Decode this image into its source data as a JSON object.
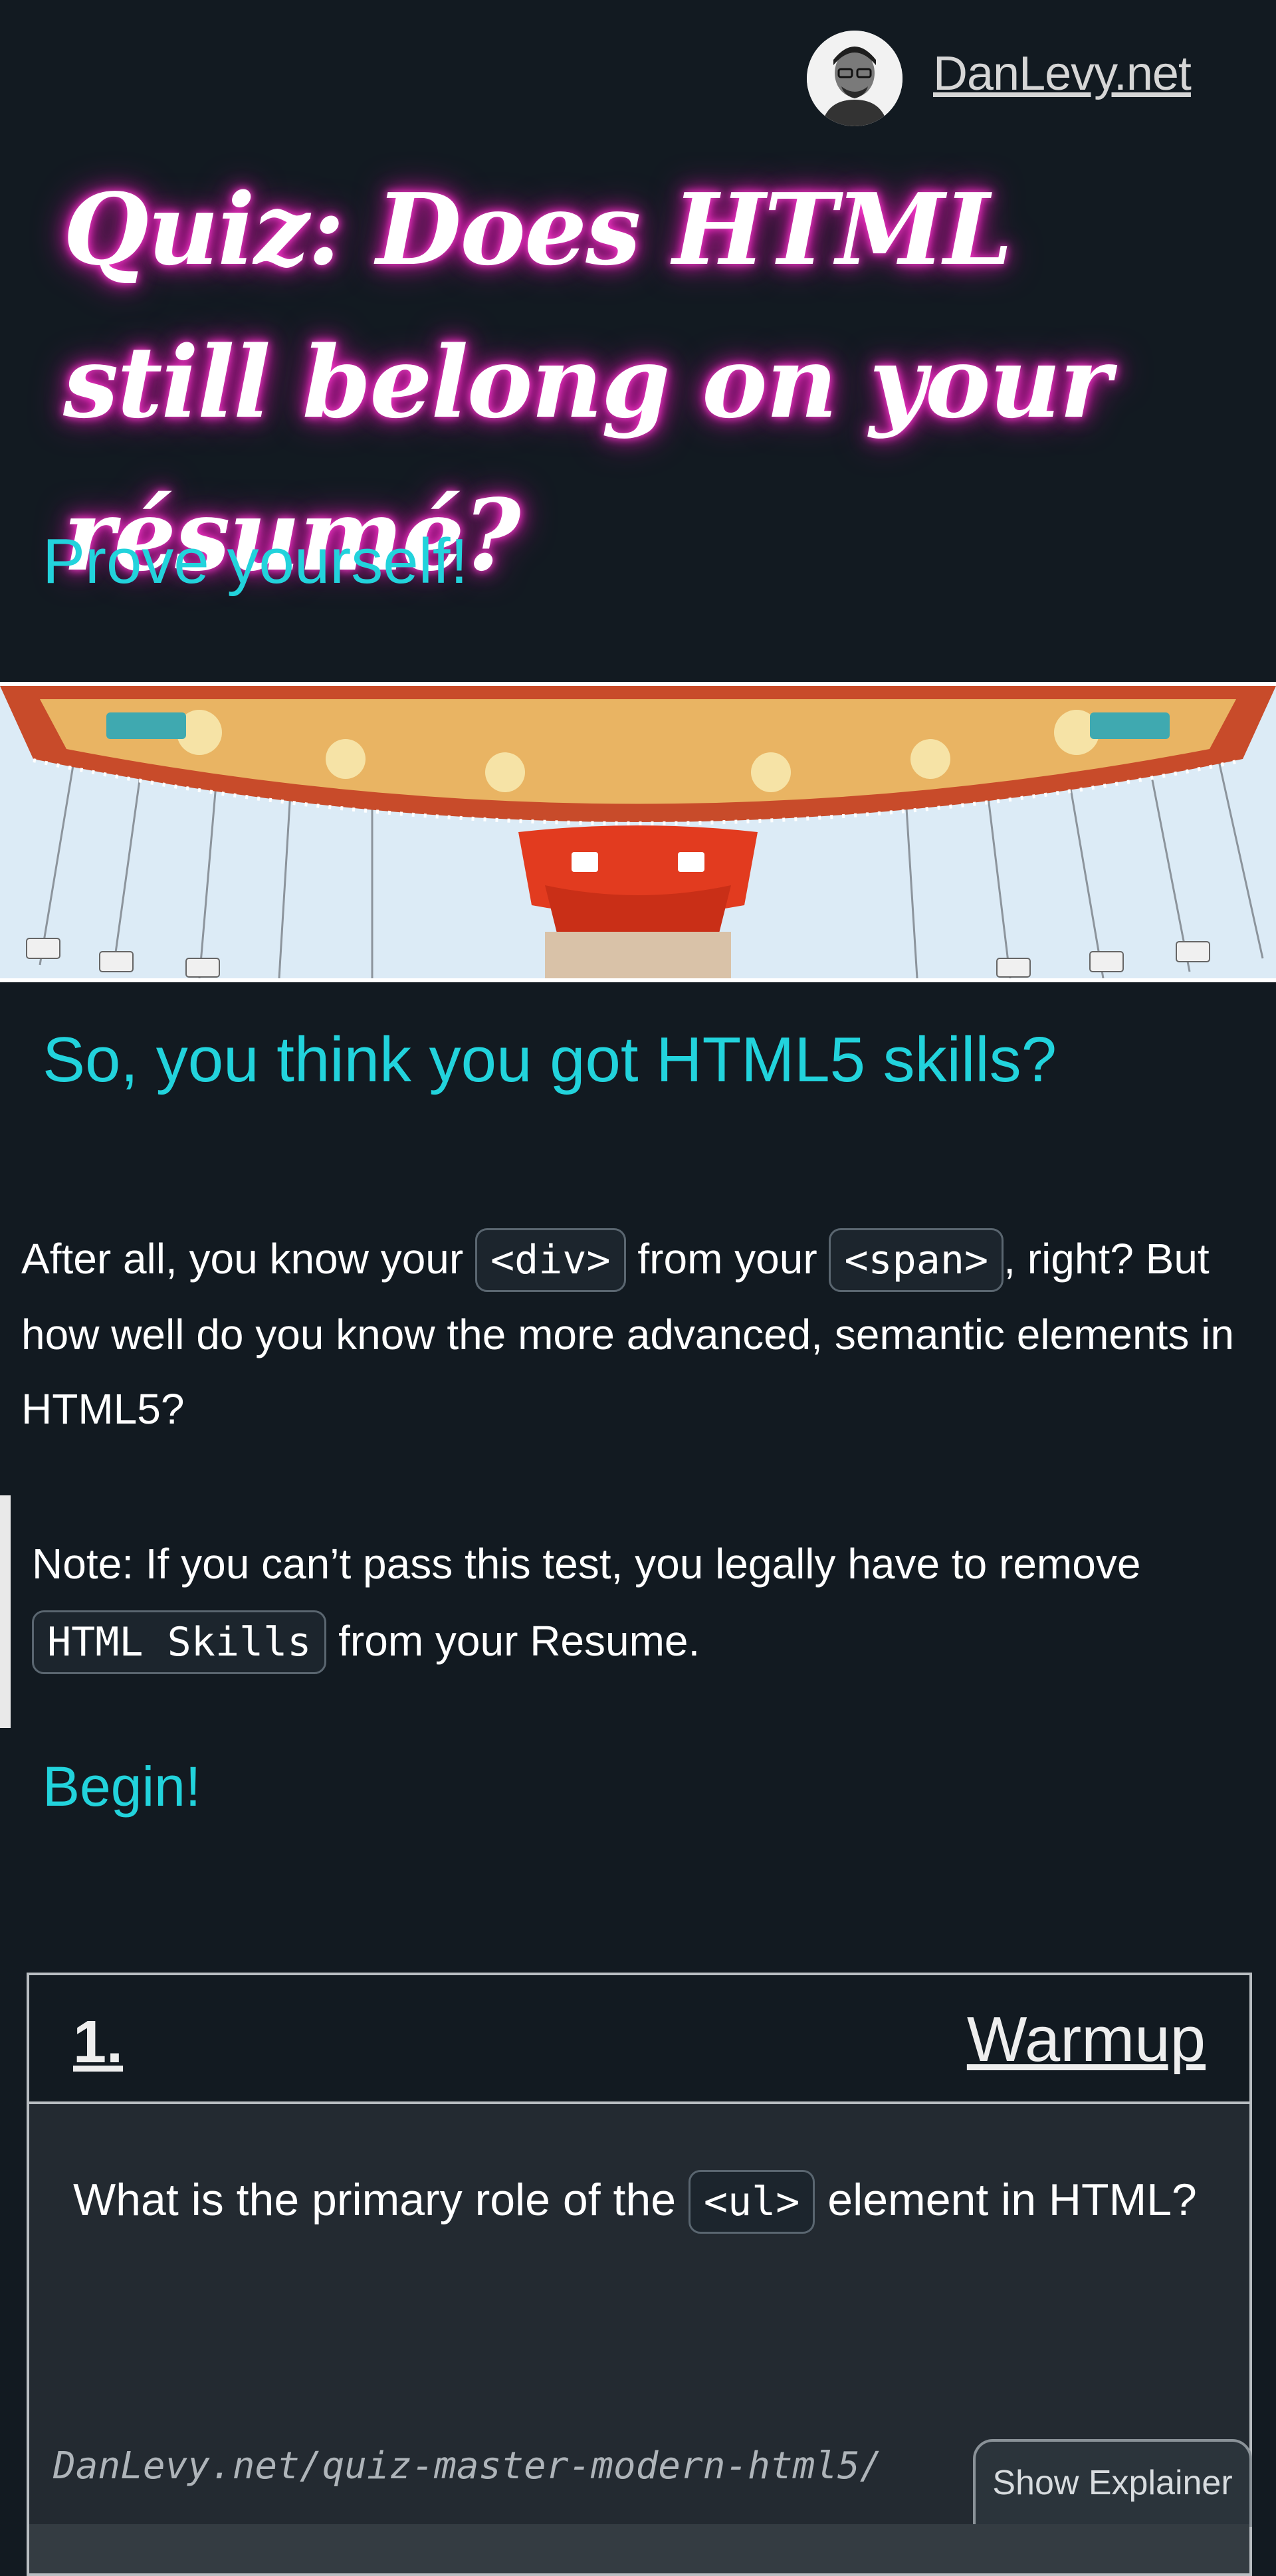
{
  "header": {
    "site_name": "DanLevy.net",
    "avatar_icon": "author-avatar"
  },
  "hero": {
    "title": "Quiz: Does HTML still belong on your résumé?",
    "subtitle": "Prove yourself!",
    "glow_color": "#e01bb3",
    "accent_color": "#22d3dc"
  },
  "banner": {
    "image": "swing-carousel-photo"
  },
  "intro": {
    "heading": "So, you think you got HTML5 skills?",
    "part1": "After all, you know your ",
    "code1": "<div>",
    "part2": " from your ",
    "code2": "<span>",
    "part3": ", right? But how well do you know the more advanced, semantic elements in HTML5?"
  },
  "note": {
    "part1": "Note: If you can’t pass this test, you legally have to remove ",
    "code": "HTML Skills",
    "part2": " from your Resume."
  },
  "begin_label": "Begin!",
  "quiz": {
    "number": "1.",
    "category": "Warmup",
    "question_part1": "What is the primary role of the ",
    "question_code": "<ul>",
    "question_part2": " element in HTML?",
    "url": "DanLevy.net/quiz-master-modern-html5/",
    "explainer_button": "Show Explainer"
  }
}
